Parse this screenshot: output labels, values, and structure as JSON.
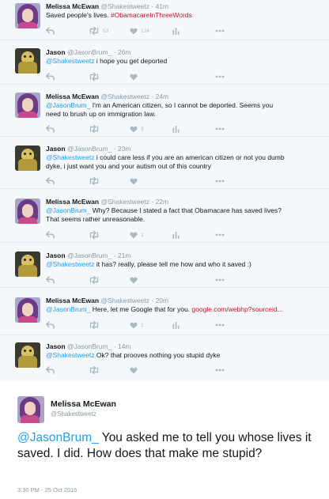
{
  "tweets": [
    {
      "author": "melissa",
      "name": "Melissa McEwan",
      "handle": "@Shakestweetz",
      "time": "· 41m",
      "text_plain": "Saved people's lives. ",
      "hashtag": "#ObamacareInThreeWords",
      "retweets": "53",
      "likes": "124",
      "show_stats": true
    },
    {
      "author": "jason",
      "name": "Jason",
      "handle": "@JasonBrum_",
      "time": "· 26m",
      "mention": "@Shakestweetz",
      "text": " i hope you get deported",
      "retweets": "",
      "likes": "",
      "show_stats": false
    },
    {
      "author": "melissa",
      "name": "Melissa McEwan",
      "handle": "@Shakestweetz",
      "time": "· 24m",
      "mention": "@JasonBrum_",
      "text_line1": " I'm an American citizen, so I cannot be deported. Seems you",
      "text_line2": "need to brush up on immigration law.",
      "retweets": "",
      "likes": "3",
      "show_stats": true
    },
    {
      "author": "jason",
      "name": "Jason",
      "handle": "@JasonBrum_",
      "time": "· 23m",
      "mention": "@Shakestweetz",
      "text_line1": " i could care less if you are an american citizen or not you dumb",
      "text_line2": "dyke, i just want you and your autism out of this country",
      "retweets": "",
      "likes": "",
      "show_stats": false
    },
    {
      "author": "melissa",
      "name": "Melissa McEwan",
      "handle": "@Shakestweetz",
      "time": "· 22m",
      "mention": "@JasonBrum_",
      "text_line1": " Why? Because I stated a fact that Obamacare has saved lives?",
      "text_line2": "That seems rather unreasonable.",
      "retweets": "",
      "likes": "1",
      "show_stats": true
    },
    {
      "author": "jason",
      "name": "Jason",
      "handle": "@JasonBrum_",
      "time": "· 21m",
      "mention": "@Shakestweetz",
      "text": " it has? really, please tell me how and who it saved :)",
      "retweets": "",
      "likes": "",
      "show_stats": false
    },
    {
      "author": "melissa",
      "name": "Melissa McEwan",
      "handle": "@Shakestweetz",
      "time": "· 20m",
      "mention": "@JasonBrum_",
      "text": " Here, let me Google that for you. ",
      "link": "google.com/webhp?sourceid...",
      "retweets": "",
      "likes": "1",
      "show_stats": true
    },
    {
      "author": "jason",
      "name": "Jason",
      "handle": "@JasonBrum_",
      "time": "· 14m",
      "mention": "@Shakestweetz",
      "text": " Ok? that prooves nothing you stupid dyke",
      "retweets": "",
      "likes": "",
      "show_stats": false
    }
  ],
  "featured": {
    "name": "Melissa McEwan",
    "handle": "@Shakestweetz",
    "mention": "@JasonBrum_",
    "text": " You asked me to tell you whose lives it saved. I did. How does that make me stupid?",
    "date": "3:30 PM - 25 Oct 2016"
  },
  "icons": {
    "reply": "reply-icon",
    "retweet": "retweet-icon",
    "like": "heart-icon",
    "stats": "analytics-icon",
    "more": "more-icon"
  },
  "colors": {
    "link": "#c8102e",
    "mention": "#1da1f2",
    "muted": "#8899a6",
    "icon": "#aab8c2"
  }
}
